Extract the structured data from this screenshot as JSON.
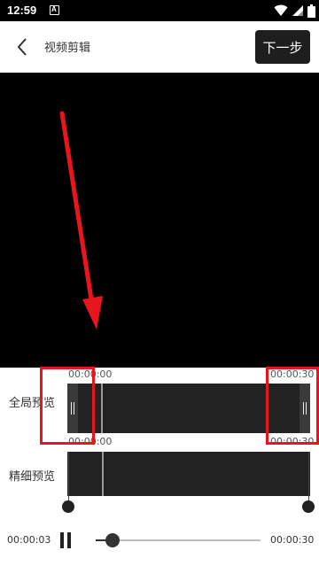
{
  "status_bar": {
    "time": "12:59",
    "notification_badge": "A",
    "icons": [
      "wifi-icon",
      "signal-icon",
      "battery-icon"
    ]
  },
  "header": {
    "back_icon": "chevron-left-icon",
    "title": "视频剪辑",
    "next_label": "下一步"
  },
  "video_preview": {
    "background": "#000000"
  },
  "global_preview": {
    "label": "全局预览",
    "start_time": "00:00:00",
    "end_time": "00:00:30",
    "handle_icon": "drag-handle-icon"
  },
  "fine_preview": {
    "label": "精细预览",
    "start_time": "00:00:00",
    "end_time": "00:00:30"
  },
  "player": {
    "current_time": "00:00:03",
    "total_time": "00:00:30",
    "pause_icon": "pause-icon",
    "progress_fraction": 0.1
  },
  "annotations": {
    "color": "#e8151c"
  }
}
